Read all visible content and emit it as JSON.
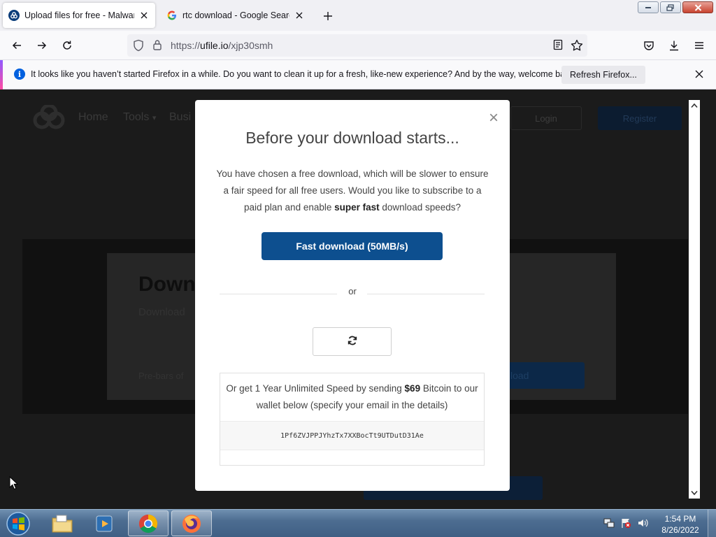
{
  "browser": {
    "tabs": [
      {
        "title": "Upload files for free - MalwareD",
        "active": true
      },
      {
        "title": "rtc download - Google Search",
        "active": false
      }
    ],
    "url": {
      "prefix": "https://",
      "host": "ufile.io",
      "path": "/xjp30smh"
    },
    "notification": {
      "message": "It looks like you haven’t started Firefox in a while. Do you want to clean it up for a fresh, like-new experience? And by the way, welcome back!",
      "button": "Refresh Firefox..."
    }
  },
  "site": {
    "nav": [
      "Home",
      "Tools",
      "Busi"
    ],
    "login": "Login",
    "register": "Register",
    "card_title": "Downl",
    "card_subtitle": "Download",
    "card_input": "Pre-bars of",
    "card_button": "load"
  },
  "modal": {
    "title": "Before your download starts...",
    "text_before": "You have chosen a free download, which will be slower to ensure a fair speed for all free users. Would you like to subscribe to a paid plan and enable ",
    "text_bold": "super fast",
    "text_after": " download speeds?",
    "fast_button": "Fast download (50MB/s)",
    "or": "or",
    "btc_before": "Or get 1 Year Unlimited Speed by sending ",
    "btc_amount": "$69",
    "btc_after": " Bitcoin to our wallet below (specify your email in the details)",
    "wallet": "1Pf6ZVJPPJYhzTx7XXBocTt9UTDutD31Ae"
  },
  "taskbar": {
    "time": "1:54 PM",
    "date": "8/26/2022"
  },
  "colors": {
    "accent_blue": "#0d4f8f",
    "firefox_blue": "#0060df"
  }
}
